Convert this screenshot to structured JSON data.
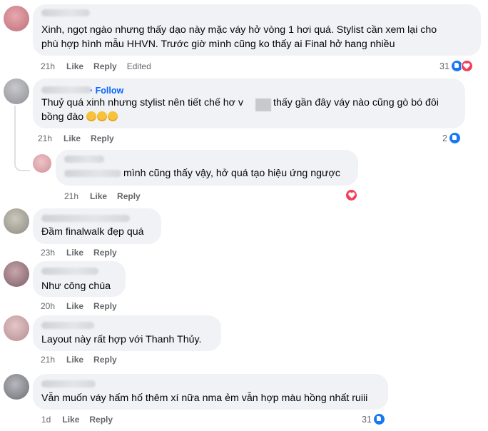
{
  "comments": [
    {
      "text_lines": [
        "Xinh, ngọt ngào nhưng thấy dạo này mặc váy hở vòng 1 hơi quá. Stylist cần xem lại cho",
        "phù hợp hình mẫu HHVN. Trước giờ mình cũng ko thấy ai Final hở hang nhiều"
      ],
      "time": "21h",
      "like": "Like",
      "reply": "Reply",
      "edited": "Edited",
      "reaction_count": "31",
      "reactions": [
        "like-icon",
        "love-icon"
      ]
    },
    {
      "follow": "· Follow",
      "text_lines": [
        "Thuỷ quá xinh nhưng stylist nên tiết chế hơ v",
        "thấy gần đây váy nào cũng gò bó đôi",
        "bồng đào"
      ],
      "time": "21h",
      "like": "Like",
      "reply": "Reply",
      "reaction_count": "2",
      "reactions": [
        "like-icon"
      ]
    },
    {
      "text": "mình cũng thấy vậy, hở quá tạo hiệu ứng ngược",
      "time": "21h",
      "like": "Like",
      "reply": "Reply",
      "reactions": [
        "love-icon"
      ]
    },
    {
      "text": "Đầm finalwalk đẹp quá",
      "time": "23h",
      "like": "Like",
      "reply": "Reply"
    },
    {
      "text": "Như công chúa",
      "time": "20h",
      "like": "Like",
      "reply": "Reply"
    },
    {
      "text": "Layout này rất hợp với Thanh Thủy.",
      "time": "21h",
      "like": "Like",
      "reply": "Reply"
    },
    {
      "text": "Vẫn muốn váy hấm hố thêm xí nữa nma ẻm vẫn hợp màu hồng nhất ruiii",
      "time": "1d",
      "like": "Like",
      "reply": "Reply",
      "reaction_count": "31",
      "reactions": [
        "like-icon"
      ]
    }
  ],
  "colors": {
    "like": "#1877f2",
    "love": "#f33e58",
    "follow": "#0866ff",
    "bubble": "#f0f2f5"
  }
}
